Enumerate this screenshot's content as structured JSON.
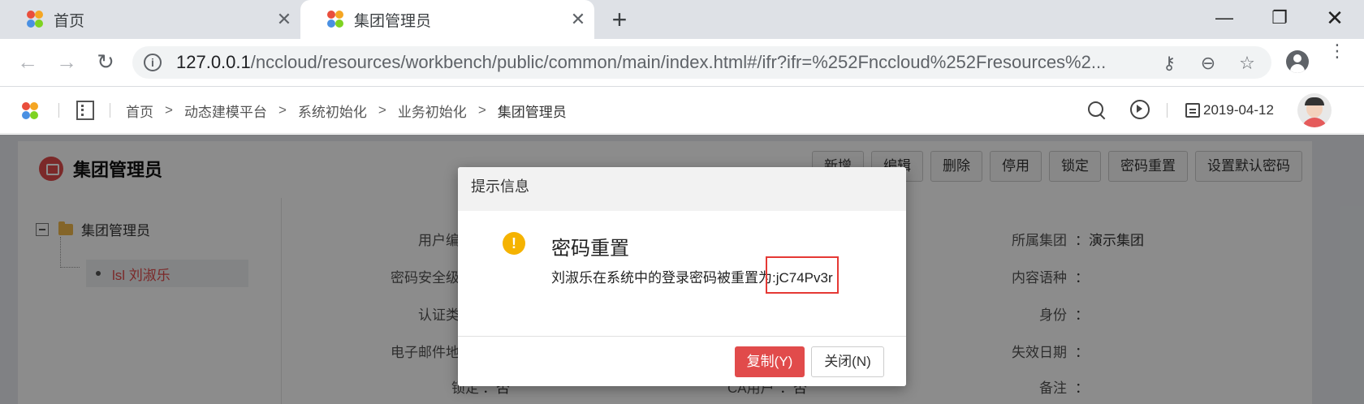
{
  "browser": {
    "tabs": [
      {
        "label": "首页",
        "close": "✕"
      },
      {
        "label": "集团管理员",
        "close": "✕"
      }
    ],
    "new_tab": "+",
    "window": {
      "minimize": "—",
      "maximize": "❐",
      "close": "✕"
    },
    "url_host": "127.0.0.1",
    "url_path": "/nccloud/resources/workbench/public/common/main/index.html#/ifr?ifr=%252Fnccloud%252Fresources%2...",
    "nav": {
      "back": "←",
      "forward": "→",
      "reload": "↻"
    },
    "omni_icons": {
      "key": "⚷",
      "zoom": "⊖",
      "star": "☆"
    },
    "menu": "⋮"
  },
  "app_header": {
    "breadcrumbs": [
      "首页",
      "动态建模平台",
      "系统初始化",
      "业务初始化",
      "集团管理员"
    ],
    "arrow": ">",
    "date": "2019-04-12"
  },
  "page": {
    "title": "集团管理员",
    "actions": [
      "新增",
      "编辑",
      "删除",
      "停用",
      "锁定",
      "密码重置",
      "设置默认密码"
    ],
    "tree": {
      "root": "集团管理员",
      "child": "lsl 刘淑乐"
    },
    "form_left": [
      {
        "label": "用户编"
      },
      {
        "label": "密码安全级"
      },
      {
        "label": "认证类"
      },
      {
        "label": "电子邮件地"
      },
      {
        "label": "锁定",
        "value": "否"
      }
    ],
    "form_mid": {
      "label": "CA用户",
      "value": "否"
    },
    "form_right": [
      {
        "label": "所属集团",
        "value": "演示集团"
      },
      {
        "label": "内容语种",
        "value": ""
      },
      {
        "label": "身份",
        "value": ""
      },
      {
        "label": "失效日期",
        "value": ""
      },
      {
        "label": "备注",
        "value": ""
      }
    ]
  },
  "dialog": {
    "header": "提示信息",
    "icon": "!",
    "title": "密码重置",
    "message": "刘淑乐在系统中的登录密码被重置为:jC74Pv3r",
    "copy_button": "复制(Y)",
    "close_button": "关闭(N)"
  },
  "colors": {
    "primary_red": "#e14b4b",
    "warning_yellow": "#f5b301",
    "highlight_red": "#e53935"
  }
}
